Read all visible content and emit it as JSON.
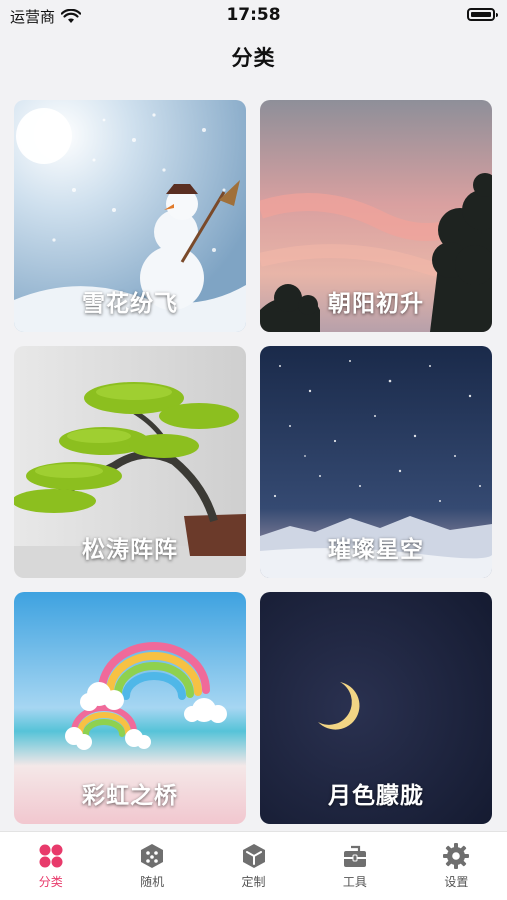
{
  "status_bar": {
    "carrier": "运营商",
    "time": "17:58"
  },
  "nav": {
    "title": "分类"
  },
  "categories": [
    {
      "label": "雪花纷飞"
    },
    {
      "label": "朝阳初升"
    },
    {
      "label": "松涛阵阵"
    },
    {
      "label": "璀璨星空"
    },
    {
      "label": "彩虹之桥"
    },
    {
      "label": "月色朦胧"
    }
  ],
  "tabbar": {
    "active_color": "#e83a6b",
    "inactive_color": "#555555",
    "items": [
      {
        "label": "分类",
        "icon": "grid-icon",
        "active": true
      },
      {
        "label": "随机",
        "icon": "dice-icon",
        "active": false
      },
      {
        "label": "定制",
        "icon": "hexagon-icon",
        "active": false
      },
      {
        "label": "工具",
        "icon": "toolbox-icon",
        "active": false
      },
      {
        "label": "设置",
        "icon": "gear-icon",
        "active": false
      }
    ]
  }
}
